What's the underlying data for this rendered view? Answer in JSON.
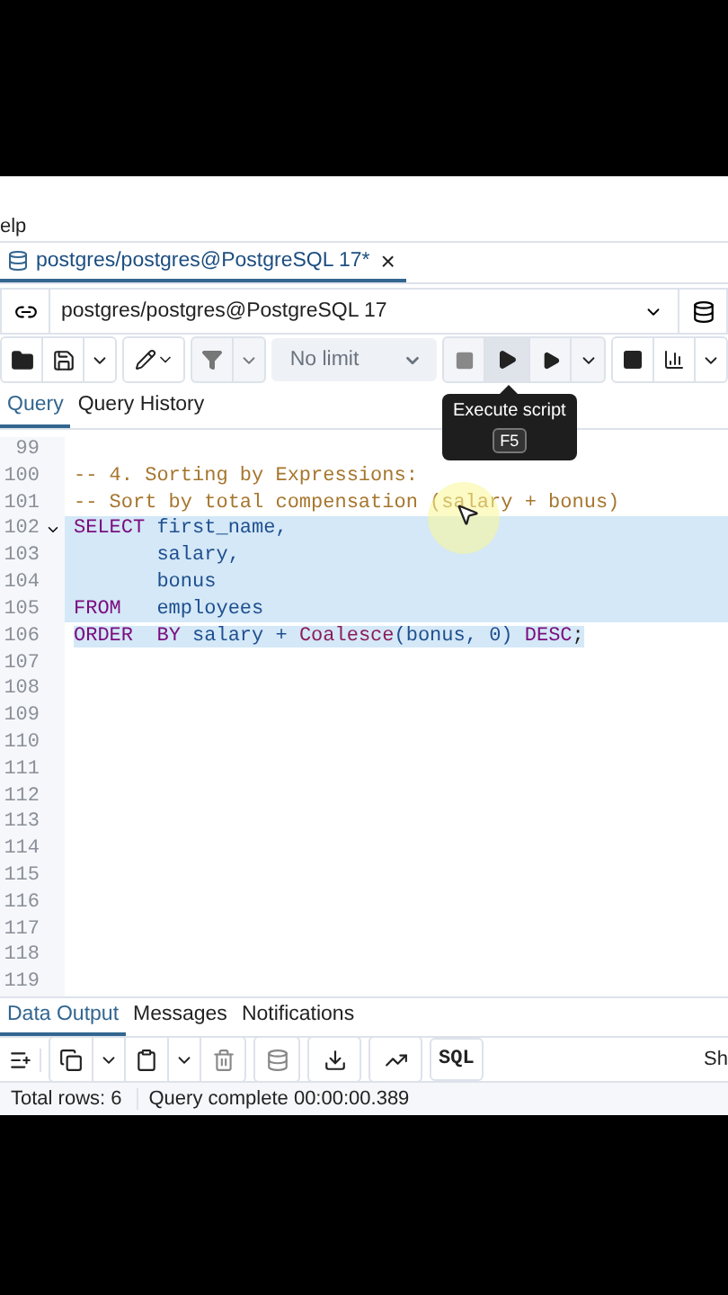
{
  "menu_bar": {
    "partial_item": "elp"
  },
  "editor_tab": {
    "title": "postgres/postgres@PostgreSQL 17*",
    "close": "×"
  },
  "connection": {
    "value": "postgres/postgres@PostgreSQL 17"
  },
  "toolbar": {
    "limit": "No limit"
  },
  "tooltip": {
    "label": "Execute script",
    "shortcut": "F5"
  },
  "query_tabs": [
    {
      "label": "Query",
      "selected": true
    },
    {
      "label": "Query History",
      "selected": false
    }
  ],
  "lines": [
    {
      "number": "99",
      "selected": false,
      "fold": false
    },
    {
      "number": "100",
      "selected": false,
      "fold": false,
      "tokens": [
        {
          "text": "-- 4. Sorting by Expressions:",
          "kind": "comment"
        }
      ]
    },
    {
      "number": "101",
      "selected": false,
      "fold": false,
      "tokens": [
        {
          "text": "-- Sort by total compensation (salary + bonus)",
          "kind": "comment"
        }
      ]
    },
    {
      "number": "102",
      "selected": true,
      "fold": true,
      "tokens": [
        {
          "text": "SELECT",
          "kind": "keyword"
        },
        {
          "text": " first_name,",
          "kind": "ident"
        }
      ]
    },
    {
      "number": "103",
      "selected": true,
      "fold": false,
      "tokens": [
        {
          "text": "       salary,",
          "kind": "ident"
        }
      ]
    },
    {
      "number": "104",
      "selected": true,
      "fold": false,
      "tokens": [
        {
          "text": "       bonus",
          "kind": "ident"
        }
      ]
    },
    {
      "number": "105",
      "selected": true,
      "fold": false,
      "tokens": [
        {
          "text": "FROM",
          "kind": "keyword"
        },
        {
          "text": "   employees",
          "kind": "ident"
        }
      ]
    },
    {
      "number": "106",
      "selected": true,
      "fold": false,
      "tokens": [
        {
          "text": "ORDER",
          "kind": "keyword"
        },
        {
          "text": "  BY",
          "kind": "keyword"
        },
        {
          "text": " salary + ",
          "kind": "ident"
        },
        {
          "text": "Coalesce",
          "kind": "function"
        },
        {
          "text": "(bonus, ",
          "kind": "ident"
        },
        {
          "text": "0",
          "kind": "number"
        },
        {
          "text": ") ",
          "kind": "ident"
        },
        {
          "text": "DESC",
          "kind": "keyword"
        },
        {
          "text": ";",
          "kind": "punct"
        }
      ]
    },
    {
      "number": "107",
      "selected": false,
      "fold": false
    },
    {
      "number": "108",
      "selected": false,
      "fold": false
    },
    {
      "number": "109",
      "selected": false,
      "fold": false
    },
    {
      "number": "110",
      "selected": false,
      "fold": false
    },
    {
      "number": "111",
      "selected": false,
      "fold": false
    },
    {
      "number": "112",
      "selected": false,
      "fold": false
    },
    {
      "number": "113",
      "selected": false,
      "fold": false
    },
    {
      "number": "114",
      "selected": false,
      "fold": false
    },
    {
      "number": "115",
      "selected": false,
      "fold": false
    },
    {
      "number": "116",
      "selected": false,
      "fold": false
    },
    {
      "number": "117",
      "selected": false,
      "fold": false
    },
    {
      "number": "118",
      "selected": false,
      "fold": false
    },
    {
      "number": "119",
      "selected": false,
      "fold": false
    }
  ],
  "output_tabs": [
    {
      "label": "Data Output",
      "selected": true
    },
    {
      "label": "Messages",
      "selected": false
    },
    {
      "label": "Notifications",
      "selected": false
    }
  ],
  "output_toolbar": {
    "sql_button": "SQL",
    "partial_item": "Sh"
  },
  "status_bar": {
    "rows": "Total rows: 6",
    "message": "Query complete 00:00:00.389"
  }
}
